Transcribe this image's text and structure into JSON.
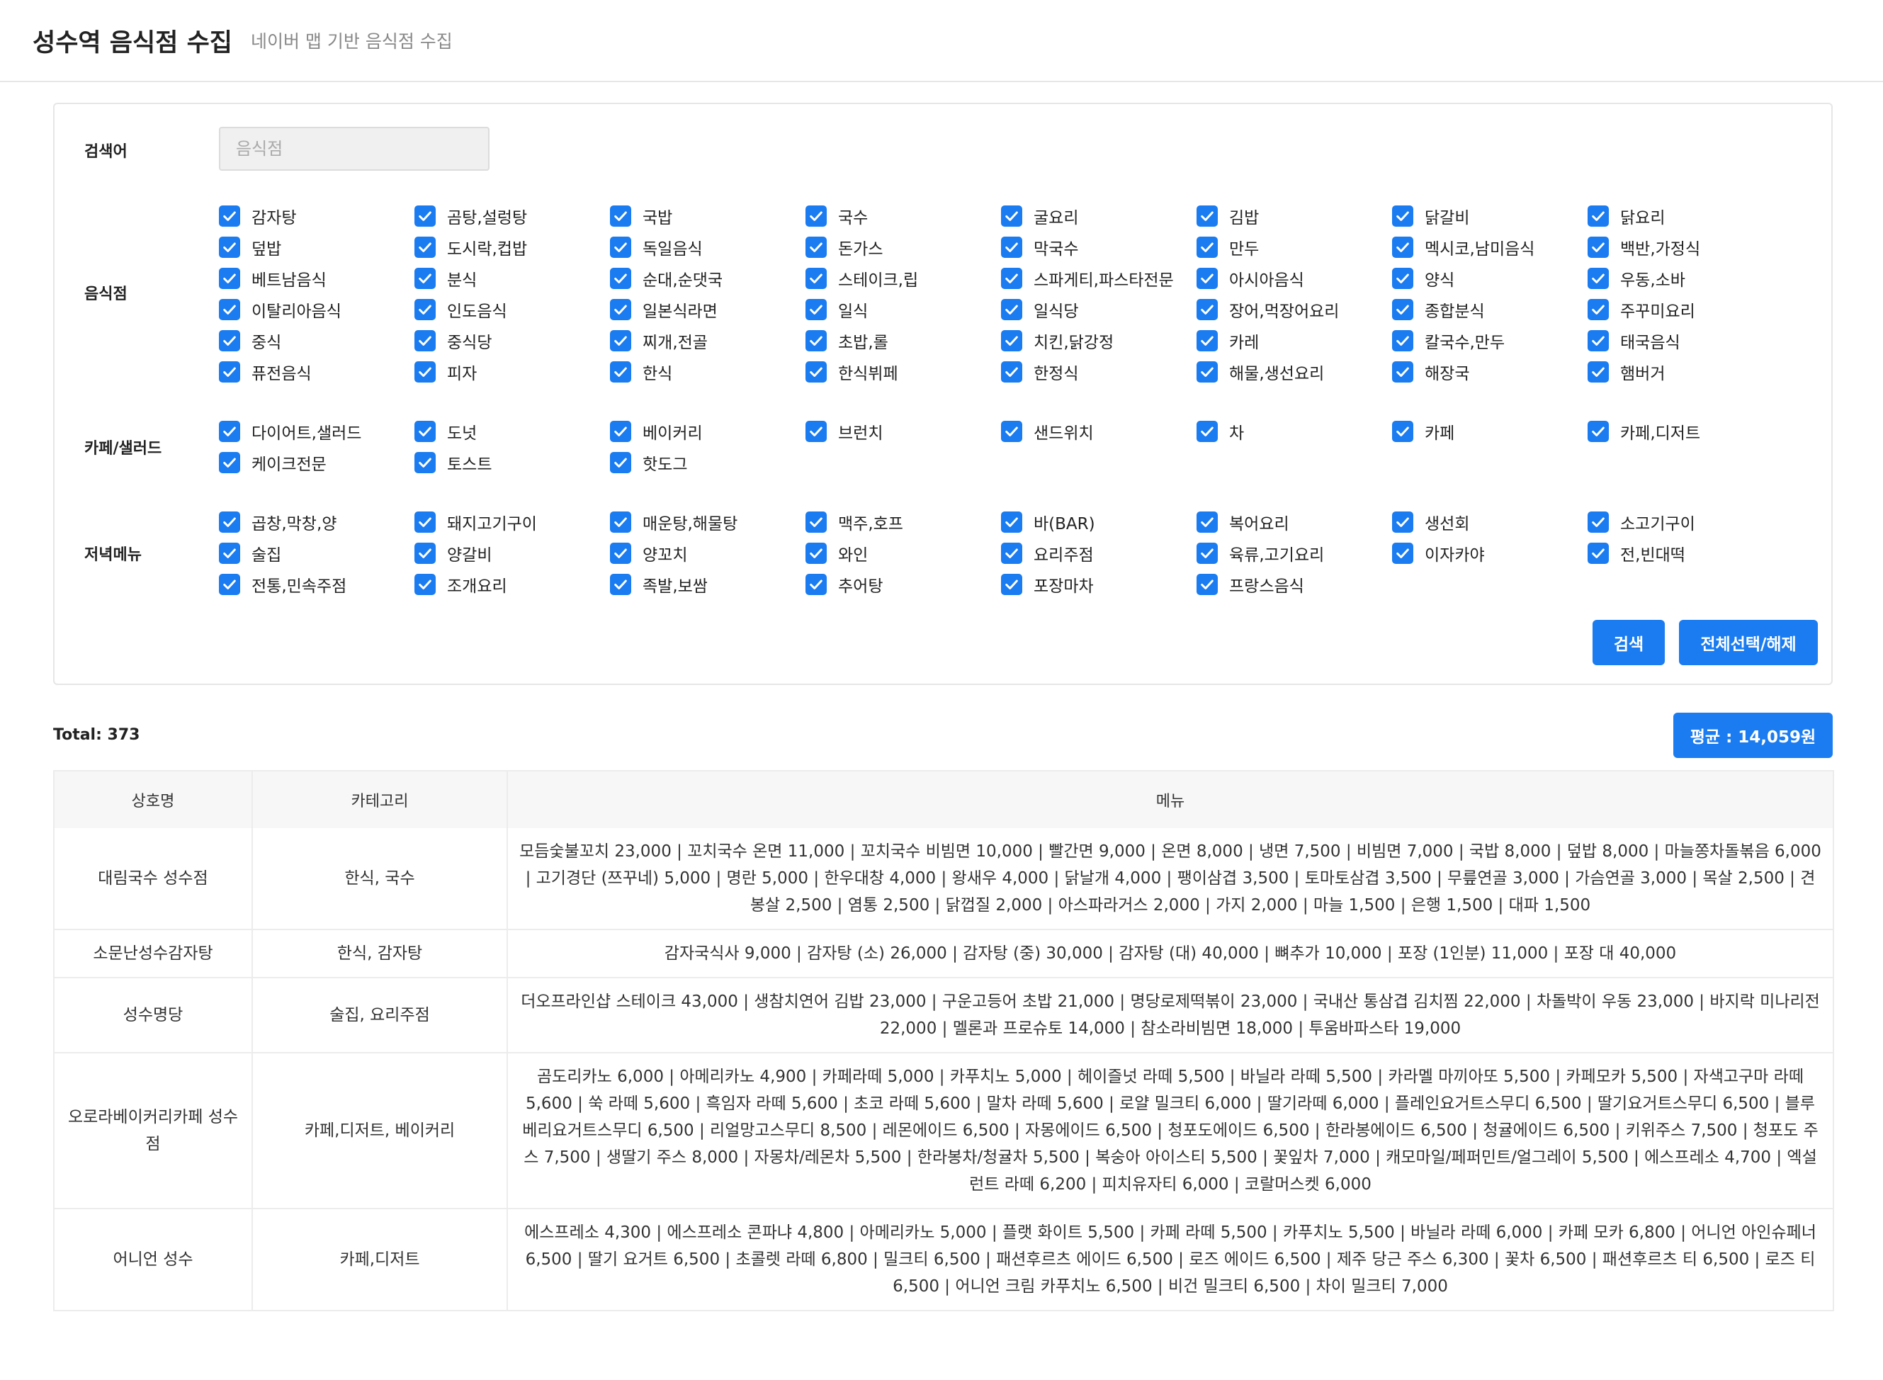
{
  "header": {
    "title": "성수역 음식점 수집",
    "subtitle": "네이버 맵 기반 음식점 수집"
  },
  "search": {
    "label": "검색어",
    "placeholder": "음식점"
  },
  "groups": [
    {
      "label": "음식점",
      "items": [
        "감자탕",
        "곰탕,설렁탕",
        "국밥",
        "국수",
        "굴요리",
        "김밥",
        "닭갈비",
        "닭요리",
        "덮밥",
        "도시락,컵밥",
        "독일음식",
        "돈가스",
        "막국수",
        "만두",
        "멕시코,남미음식",
        "백반,가정식",
        "베트남음식",
        "분식",
        "순대,순댓국",
        "스테이크,립",
        "스파게티,파스타전문",
        "아시아음식",
        "양식",
        "우동,소바",
        "이탈리아음식",
        "인도음식",
        "일본식라면",
        "일식",
        "일식당",
        "장어,먹장어요리",
        "종합분식",
        "주꾸미요리",
        "중식",
        "중식당",
        "찌개,전골",
        "초밥,롤",
        "치킨,닭강정",
        "카레",
        "칼국수,만두",
        "태국음식",
        "퓨전음식",
        "피자",
        "한식",
        "한식뷔페",
        "한정식",
        "해물,생선요리",
        "해장국",
        "햄버거"
      ]
    },
    {
      "label": "카페/샐러드",
      "items": [
        "다이어트,샐러드",
        "도넛",
        "베이커리",
        "브런치",
        "샌드위치",
        "차",
        "카페",
        "카페,디저트",
        "케이크전문",
        "토스트",
        "핫도그"
      ]
    },
    {
      "label": "저녁메뉴",
      "items": [
        "곱창,막창,양",
        "돼지고기구이",
        "매운탕,해물탕",
        "맥주,호프",
        "바(BAR)",
        "복어요리",
        "생선회",
        "소고기구이",
        "술집",
        "양갈비",
        "양꼬치",
        "와인",
        "요리주점",
        "육류,고기요리",
        "이자카야",
        "전,빈대떡",
        "전통,민속주점",
        "조개요리",
        "족발,보쌈",
        "추어탕",
        "포장마차",
        "프랑스음식"
      ]
    }
  ],
  "buttons": {
    "search": "검색",
    "toggle_all": "전체선택/해제"
  },
  "summary": {
    "total": "Total: 373",
    "average": "평균 : 14,059원"
  },
  "table": {
    "headers": [
      "상호명",
      "카테고리",
      "메뉴"
    ],
    "rows": [
      {
        "name": "대림국수 성수점",
        "category": "한식, 국수",
        "menu": "모듬숯불꼬치 23,000 | 꼬치국수 온면 11,000 | 꼬치국수 비빔면 10,000 | 빨간면 9,000 | 온면 8,000 | 냉면 7,500 | 비빔면 7,000 | 국밥 8,000 | 덮밥 8,000 | 마늘쫑차돌볶음 6,000 | 고기경단 (쯔꾸네) 5,000 | 명란 5,000 | 한우대창 4,000 | 왕새우 4,000 | 닭날개 4,000 | 팽이삼겹 3,500 | 토마토삼겹 3,500 | 무릎연골 3,000 | 가슴연골 3,000 | 목살 2,500 | 견봉살 2,500 | 염통 2,500 | 닭껍질 2,000 | 아스파라거스 2,000 | 가지 2,000 | 마늘 1,500 | 은행 1,500 | 대파 1,500"
      },
      {
        "name": "소문난성수감자탕",
        "category": "한식, 감자탕",
        "menu": "감자국식사 9,000 | 감자탕 (소) 26,000 | 감자탕 (중) 30,000 | 감자탕 (대) 40,000 | 뼈추가 10,000 | 포장 (1인분) 11,000 | 포장 대 40,000"
      },
      {
        "name": "성수명당",
        "category": "술집, 요리주점",
        "menu": "더오프라인샵 스테이크 43,000 | 생참치연어 김밥 23,000 | 구운고등어 초밥 21,000 | 명당로제떡볶이 23,000 | 국내산 통삼겹 김치찜 22,000 | 차돌박이 우동 23,000 | 바지락 미나리전 22,000 | 멜론과 프로슈토 14,000 | 참소라비빔면 18,000 | 투움바파스타 19,000"
      },
      {
        "name": "오로라베이커리카페 성수점",
        "category": "카페,디저트, 베이커리",
        "menu": "곰도리카노 6,000 | 아메리카노 4,900 | 카페라떼 5,000 | 카푸치노 5,000 | 헤이즐넛 라떼 5,500 | 바닐라 라떼 5,500 | 카라멜 마끼아또 5,500 | 카페모카 5,500 | 자색고구마 라떼 5,600 | 쑥 라떼 5,600 | 흑임자 라떼 5,600 | 초코 라떼 5,600 | 말차 라떼 5,600 | 로얄 밀크티 6,000 | 딸기라떼 6,000 | 플레인요거트스무디 6,500 | 딸기요거트스무디 6,500 | 블루베리요거트스무디 6,500 | 리얼망고스무디 8,500 | 레몬에이드 6,500 | 자몽에이드 6,500 | 청포도에이드 6,500 | 한라봉에이드 6,500 | 청귤에이드 6,500 | 키위주스 7,500 | 청포도 주스 7,500 | 생딸기 주스 8,000 | 자몽차/레몬차 5,500 | 한라봉차/청귤차 5,500 | 복숭아 아이스티 5,500 | 꽃잎차 7,000 | 캐모마일/페퍼민트/얼그레이 5,500 | 에스프레소 4,700 | 엑설런트 라떼 6,200 | 피치유자티 6,000 | 코랄머스켓 6,000"
      },
      {
        "name": "어니언 성수",
        "category": "카페,디저트",
        "menu": "에스프레소 4,300 | 에스프레소 콘파냐 4,800 | 아메리카노 5,000 | 플랫 화이트 5,500 | 카페 라떼 5,500 | 카푸치노 5,500 | 바닐라 라떼 6,000 | 카페 모카 6,800 | 어니언 아인슈페너 6,500 | 딸기 요거트 6,500 | 초콜렛 라떼 6,800 | 밀크티 6,500 | 패션후르츠 에이드 6,500 | 로즈 에이드 6,500 | 제주 당근 주스 6,300 | 꽃차 6,500 | 패션후르츠 티 6,500 | 로즈 티 6,500 | 어니언 크림 카푸치노 6,500 | 비건 밀크티 6,500 | 차이 밀크티 7,000"
      }
    ]
  }
}
